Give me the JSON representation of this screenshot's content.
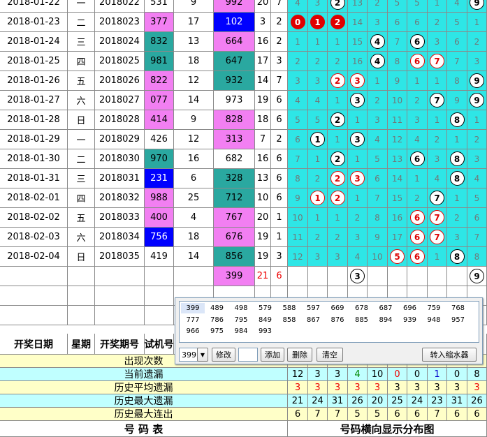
{
  "rows": [
    {
      "date": "2018-01-22",
      "wk": "一",
      "issue": "2018022",
      "test": "531",
      "ts": "9",
      "open": "992",
      "os": "20",
      "ok": "7",
      "tcol": "w",
      "ocol": "m",
      "dist": [
        "4",
        "3",
        "2",
        "13",
        "2",
        "5",
        "5",
        "1",
        "4",
        "9"
      ],
      "balls": [
        2,
        9
      ]
    },
    {
      "date": "2018-01-23",
      "wk": "二",
      "issue": "2018023",
      "test": "377",
      "ts": "17",
      "open": "102",
      "os": "3",
      "ok": "2",
      "tcol": "m",
      "ocol": "b",
      "dist": [
        "0",
        "1",
        "2",
        "14",
        "3",
        "6",
        "6",
        "2",
        "5",
        "1"
      ],
      "balls": [
        0,
        1,
        2
      ],
      "red": true
    },
    {
      "date": "2018-01-24",
      "wk": "三",
      "issue": "2018024",
      "test": "832",
      "ts": "13",
      "open": "664",
      "os": "16",
      "ok": "2",
      "tcol": "t",
      "ocol": "m",
      "dist": [
        "1",
        "1",
        "1",
        "15",
        "4",
        "7",
        "6",
        "3",
        "6",
        "2"
      ],
      "balls": [
        4,
        6
      ]
    },
    {
      "date": "2018-01-25",
      "wk": "四",
      "issue": "2018025",
      "test": "981",
      "ts": "18",
      "open": "647",
      "os": "17",
      "ok": "3",
      "tcol": "t",
      "ocol": "t",
      "dist": [
        "2",
        "2",
        "2",
        "16",
        "4",
        "8",
        "6",
        "7",
        "7",
        "3"
      ],
      "balls": [
        4,
        6,
        7
      ],
      "orange": [
        6,
        7
      ]
    },
    {
      "date": "2018-01-26",
      "wk": "五",
      "issue": "2018026",
      "test": "822",
      "ts": "12",
      "open": "932",
      "os": "14",
      "ok": "7",
      "tcol": "m",
      "ocol": "t",
      "dist": [
        "3",
        "3",
        "2",
        "3",
        "1",
        "9",
        "1",
        "1",
        "8",
        "9"
      ],
      "balls": [
        2,
        3,
        9
      ],
      "orange": [
        2,
        3
      ]
    },
    {
      "date": "2018-01-27",
      "wk": "六",
      "issue": "2018027",
      "test": "077",
      "ts": "14",
      "open": "973",
      "os": "19",
      "ok": "6",
      "tcol": "m",
      "ocol": "w",
      "dist": [
        "4",
        "4",
        "1",
        "3",
        "2",
        "10",
        "2",
        "7",
        "9",
        "9"
      ],
      "balls": [
        3,
        7,
        9
      ]
    },
    {
      "date": "2018-01-28",
      "wk": "日",
      "issue": "2018028",
      "test": "414",
      "ts": "9",
      "open": "828",
      "os": "18",
      "ok": "6",
      "tcol": "m",
      "ocol": "m",
      "dist": [
        "5",
        "5",
        "2",
        "1",
        "3",
        "11",
        "3",
        "1",
        "8",
        "1"
      ],
      "balls": [
        2,
        8
      ]
    },
    {
      "date": "2018-01-29",
      "wk": "一",
      "issue": "2018029",
      "test": "426",
      "ts": "12",
      "open": "313",
      "os": "7",
      "ok": "2",
      "tcol": "w",
      "ocol": "m",
      "dist": [
        "6",
        "1",
        "1",
        "3",
        "4",
        "12",
        "4",
        "2",
        "1",
        "2"
      ],
      "balls": [
        1,
        3
      ]
    },
    {
      "date": "2018-01-30",
      "wk": "二",
      "issue": "2018030",
      "test": "970",
      "ts": "16",
      "open": "682",
      "os": "16",
      "ok": "6",
      "tcol": "t",
      "ocol": "w",
      "dist": [
        "7",
        "1",
        "2",
        "1",
        "5",
        "13",
        "6",
        "3",
        "8",
        "3"
      ],
      "balls": [
        2,
        6,
        8
      ]
    },
    {
      "date": "2018-01-31",
      "wk": "三",
      "issue": "2018031",
      "test": "231",
      "ts": "6",
      "open": "328",
      "os": "13",
      "ok": "6",
      "tcol": "b",
      "ocol": "t",
      "dist": [
        "8",
        "2",
        "2",
        "3",
        "6",
        "14",
        "1",
        "4",
        "8",
        "4"
      ],
      "balls": [
        2,
        3,
        8
      ],
      "orange": [
        2,
        3
      ]
    },
    {
      "date": "2018-02-01",
      "wk": "四",
      "issue": "2018032",
      "test": "988",
      "ts": "25",
      "open": "712",
      "os": "10",
      "ok": "6",
      "tcol": "m",
      "ocol": "t",
      "dist": [
        "9",
        "1",
        "2",
        "1",
        "7",
        "15",
        "2",
        "7",
        "1",
        "5"
      ],
      "balls": [
        1,
        2,
        7
      ],
      "orange": [
        1,
        2
      ]
    },
    {
      "date": "2018-02-02",
      "wk": "五",
      "issue": "2018033",
      "test": "400",
      "ts": "4",
      "open": "767",
      "os": "20",
      "ok": "1",
      "tcol": "m",
      "ocol": "m",
      "dist": [
        "10",
        "1",
        "1",
        "2",
        "8",
        "16",
        "6",
        "7",
        "2",
        "6"
      ],
      "balls": [
        6,
        7
      ],
      "orange": [
        6,
        7
      ]
    },
    {
      "date": "2018-02-03",
      "wk": "六",
      "issue": "2018034",
      "test": "756",
      "ts": "18",
      "open": "676",
      "os": "19",
      "ok": "1",
      "tcol": "b",
      "ocol": "m",
      "dist": [
        "11",
        "2",
        "2",
        "3",
        "9",
        "17",
        "6",
        "7",
        "3",
        "7"
      ],
      "balls": [
        6,
        7
      ],
      "orange": [
        6,
        7
      ]
    },
    {
      "date": "2018-02-04",
      "wk": "日",
      "issue": "2018035",
      "test": "419",
      "ts": "14",
      "open": "856",
      "os": "19",
      "ok": "3",
      "tcol": "w",
      "ocol": "t",
      "dist": [
        "12",
        "3",
        "3",
        "4",
        "10",
        "5",
        "6",
        "1",
        "8",
        "8"
      ],
      "balls": [
        5,
        6,
        8
      ],
      "orange": [
        5,
        6
      ]
    }
  ],
  "pred": {
    "open": "399",
    "os": "21",
    "ok": "6",
    "balls": [
      "3",
      "9"
    ]
  },
  "header": {
    "date": "开奖日期",
    "wk": "星期",
    "issue": "开奖期号",
    "test": "试机号"
  },
  "stats": [
    {
      "label": "出现次数",
      "vals": [],
      "color": "#000"
    },
    {
      "label": "当前遗漏",
      "vals": [
        "12",
        "3",
        "3",
        "4",
        "10",
        "0",
        "0",
        "1",
        "0",
        "8"
      ],
      "colors": [
        "#000",
        "#000",
        "#000",
        "#080",
        "#000",
        "#e00",
        "#000",
        "#00c",
        "#000",
        "#000"
      ]
    },
    {
      "label": "历史平均遗漏",
      "vals": [
        "3",
        "3",
        "3",
        "3",
        "3",
        "3",
        "3",
        "3",
        "3",
        "3"
      ],
      "colors": [
        "#e00",
        "#e00",
        "#e00",
        "#e00",
        "#e00",
        "#000",
        "#000",
        "#000",
        "#000",
        "#e00"
      ]
    },
    {
      "label": "历史最大遗漏",
      "vals": [
        "21",
        "24",
        "31",
        "26",
        "20",
        "25",
        "24",
        "23",
        "31",
        "26"
      ]
    },
    {
      "label": "历史最大连出",
      "vals": [
        "6",
        "7",
        "7",
        "5",
        "5",
        "6",
        "6",
        "7",
        "6",
        "6"
      ]
    }
  ],
  "footer": {
    "left": "号    码    表",
    "right": "号码横向显示分布图"
  },
  "popup": {
    "items": [
      "399",
      "489",
      "498",
      "579",
      "588",
      "597",
      "669",
      "678",
      "687",
      "696",
      "759",
      "768",
      "777",
      "786",
      "795",
      "849",
      "858",
      "867",
      "876",
      "885",
      "894",
      "939",
      "948",
      "957",
      "966",
      "975",
      "984",
      "993"
    ],
    "selected": "399",
    "select_value": "399",
    "btn_modify": "修改",
    "btn_add": "添加",
    "btn_delete": "删除",
    "btn_clear": "清空",
    "btn_shrink": "转入缩水器"
  },
  "colors": {
    "cyan": "#2ee6e6",
    "magenta": "#f27ff2",
    "teal": "#2aa8a0",
    "blue": "#0000ff",
    "statYellow": "#ffffc8",
    "statCyan": "#c0ffff",
    "red": "#e00000"
  }
}
